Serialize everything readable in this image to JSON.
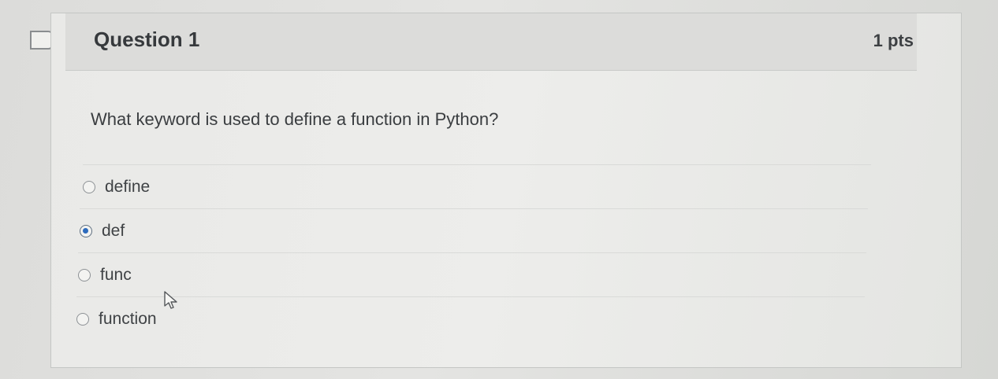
{
  "quiz": {
    "question": {
      "title": "Question 1",
      "points": "1 pts",
      "text": "What keyword is used to define a function in Python?"
    },
    "answers": [
      {
        "label": "define",
        "selected": false
      },
      {
        "label": "def",
        "selected": true
      },
      {
        "label": "func",
        "selected": false
      },
      {
        "label": "function",
        "selected": false
      }
    ],
    "colors": {
      "selected_radio": "#2d6bbd",
      "header_background": "#dcdcda",
      "card_border": "#c4c6c4"
    },
    "icons": {
      "flag": "flag-question-icon",
      "cursor": "mouse-pointer-icon"
    }
  }
}
